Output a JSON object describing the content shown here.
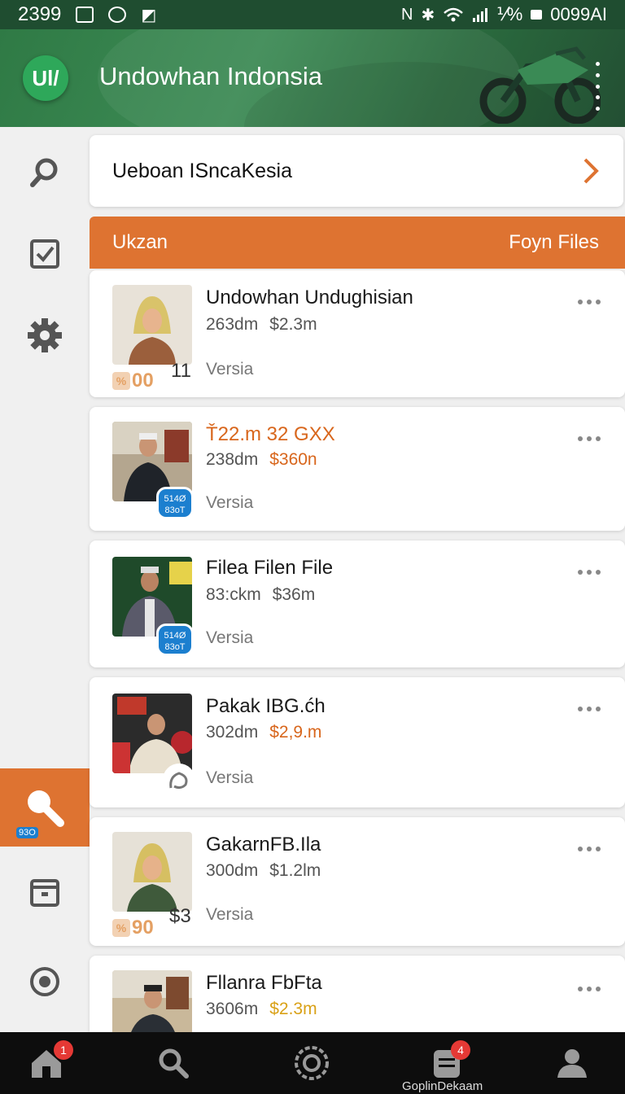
{
  "status_bar": {
    "time_left": "2399",
    "signal_text": "⅟%",
    "time_right": "0099AI"
  },
  "header": {
    "logo_text": "Ul/",
    "title": "Undowhan Indonsia"
  },
  "search": {
    "value": "Ueboan ISncaKesia"
  },
  "section": {
    "left_label": "Ukzan",
    "right_label": "Foyn Files"
  },
  "items": [
    {
      "title": "Undowhan Undughisian",
      "size": "263dm",
      "price": "$2.3m",
      "version": "Versia",
      "badge_off": "00",
      "count": "11"
    },
    {
      "title": "Ť22.m  32 GXX",
      "size": "238dm",
      "price": "$360n",
      "version": "Versia",
      "badge_blue": "514Ø 83oT"
    },
    {
      "title": "Filea Filen File",
      "size": "83:ckm",
      "price": "$36m",
      "version": "Versia",
      "badge_blue": "514Ø 83oT"
    },
    {
      "title": "Pakak IBG.ćh",
      "size": "302dm",
      "price": "$2,9.m",
      "version": "Versia"
    },
    {
      "title": "GakarnFB.Ila",
      "size": "300dm",
      "price": "$1.2lm",
      "version": "Versia",
      "badge_off": "90",
      "count": "$3"
    },
    {
      "title": "Fllanra FbFta",
      "size": "3606m",
      "price": "$2.3m",
      "version": ""
    }
  ],
  "rail": {
    "badge_text": "93O"
  },
  "bottom_nav": {
    "home_badge": "1",
    "docs_badge": "4",
    "label": "GoplinDekaam"
  },
  "colors": {
    "accent": "#de7331",
    "header_green": "#2f7a45",
    "badge_blue": "#1c7fcf"
  }
}
